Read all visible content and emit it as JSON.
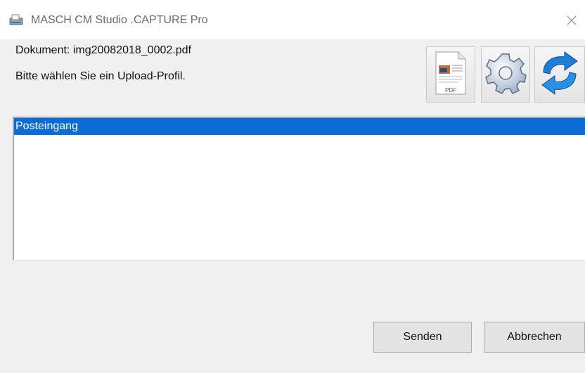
{
  "window": {
    "title": "MASCH CM Studio .CAPTURE Pro",
    "app_icon": "scanner-app-icon",
    "close_icon": "close-icon"
  },
  "info": {
    "document_label": "Dokument: img20082018_0002.pdf",
    "hint": "Bitte wählen Sie ein Upload-Profil."
  },
  "toolbar": {
    "pdf_icon": "pdf-document-icon",
    "pdf_icon_text": "PDF",
    "settings_icon": "gear-icon",
    "refresh_icon": "refresh-arrows-icon"
  },
  "profiles": {
    "items": [
      {
        "label": "Posteingang",
        "selected": true
      }
    ]
  },
  "buttons": {
    "send": "Senden",
    "cancel": "Abbrechen"
  },
  "colors": {
    "selection": "#0a6cd4",
    "refresh_blue": "#1f7fd6"
  }
}
